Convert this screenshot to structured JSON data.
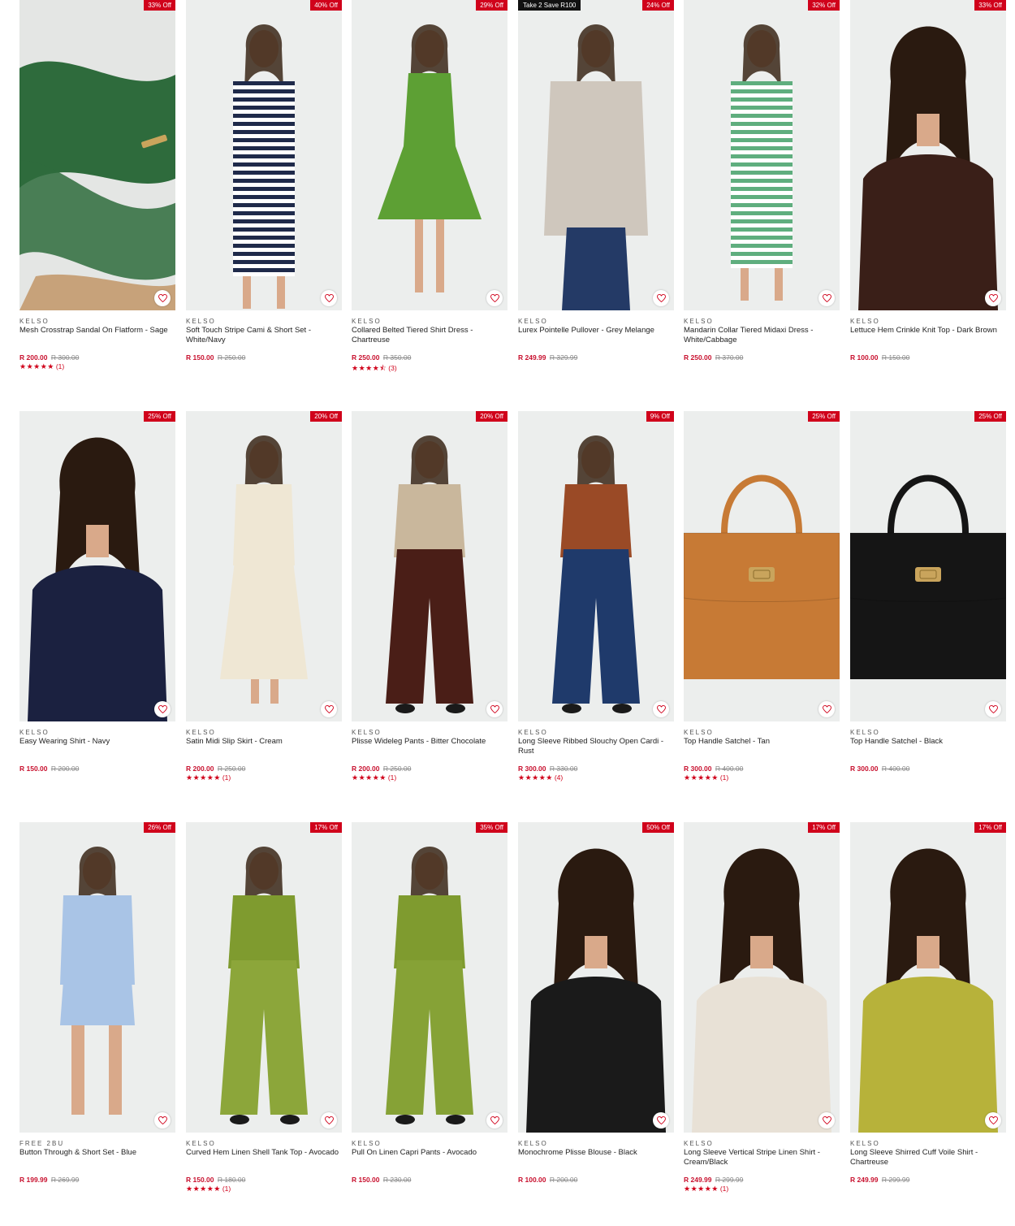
{
  "colors": {
    "accent": "#d0021b",
    "price": "#c8102e",
    "image_bg": "#eceeed"
  },
  "products": [
    {
      "badge": "33% Off",
      "promo": "",
      "brand": "KELSO",
      "name": "Mesh Crosstrap Sandal On Flatform - Sage",
      "price": "R 200.00",
      "was": "R 300.00",
      "stars": "★★★★★",
      "reviews": "(1)",
      "kind": "sandal",
      "color": "#2e6b3c",
      "rating_value": 5
    },
    {
      "badge": "40% Off",
      "promo": "",
      "brand": "KELSO",
      "name": "Soft Touch Stripe Cami & Short Set - White/Navy",
      "price": "R 150.00",
      "was": "R 250.00",
      "stars": "",
      "reviews": "",
      "kind": "stripe",
      "color": "#1f2a4a"
    },
    {
      "badge": "29% Off",
      "promo": "",
      "brand": "KELSO",
      "name": "Collared Belted Tiered Shirt Dress - Chartreuse",
      "price": "R 250.00",
      "was": "R 350.00",
      "stars": "★★★★⯪",
      "reviews": "(3)",
      "kind": "dress",
      "color": "#5da034",
      "rating_value": 4.5
    },
    {
      "badge": "24% Off",
      "promo": "Take 2 Save R100",
      "brand": "KELSO",
      "name": "Lurex Pointelle Pullover - Grey Melange",
      "price": "R 249.99",
      "was": "R 329.99",
      "stars": "",
      "reviews": "",
      "kind": "top-jeans",
      "color": "#cfc7bd"
    },
    {
      "badge": "32% Off",
      "promo": "",
      "brand": "KELSO",
      "name": "Mandarin Collar Tiered Midaxi Dress - White/Cabbage",
      "price": "R 250.00",
      "was": "R 370.00",
      "stars": "",
      "reviews": "",
      "kind": "stripe-dress",
      "color": "#5fae7e"
    },
    {
      "badge": "33% Off",
      "promo": "",
      "brand": "KELSO",
      "name": "Lettuce Hem Crinkle Knit Top - Dark Brown",
      "price": "R 100.00",
      "was": "R 150.00",
      "stars": "",
      "reviews": "",
      "kind": "portrait",
      "color": "#3a1f18"
    },
    {
      "badge": "25% Off",
      "promo": "",
      "brand": "KELSO",
      "name": "Easy Wearing Shirt - Navy",
      "price": "R 150.00",
      "was": "R 200.00",
      "stars": "",
      "reviews": "",
      "kind": "portrait",
      "color": "#1b2140"
    },
    {
      "badge": "20% Off",
      "promo": "",
      "brand": "KELSO",
      "name": "Satin Midi Slip Skirt - Cream",
      "price": "R 200.00",
      "was": "R 250.00",
      "stars": "★★★★★",
      "reviews": "(1)",
      "kind": "full",
      "color": "#efe7d4",
      "rating_value": 5
    },
    {
      "badge": "20% Off",
      "promo": "",
      "brand": "KELSO",
      "name": "Plisse Wideleg Pants - Bitter Chocolate",
      "price": "R 200.00",
      "was": "R 250.00",
      "stars": "★★★★★",
      "reviews": "(1)",
      "kind": "top-pants",
      "color": "#4a1e17",
      "color2": "#c9b79c",
      "rating_value": 5
    },
    {
      "badge": "9% Off",
      "promo": "",
      "brand": "KELSO",
      "name": "Long Sleeve Ribbed Slouchy Open Cardi - Rust",
      "price": "R 300.00",
      "was": "R 330.00",
      "stars": "★★★★★",
      "reviews": "(4)",
      "kind": "top-pants",
      "color": "#1f3a6b",
      "color2": "#9a4a26",
      "rating_value": 5
    },
    {
      "badge": "25% Off",
      "promo": "",
      "brand": "KELSO",
      "name": "Top Handle Satchel - Tan",
      "price": "R 300.00",
      "was": "R 400.00",
      "stars": "★★★★★",
      "reviews": "(1)",
      "kind": "bag",
      "color": "#c77a35",
      "rating_value": 5
    },
    {
      "badge": "25% Off",
      "promo": "",
      "brand": "KELSO",
      "name": "Top Handle Satchel - Black",
      "price": "R 300.00",
      "was": "R 400.00",
      "stars": "",
      "reviews": "",
      "kind": "bag",
      "color": "#151515"
    },
    {
      "badge": "26% Off",
      "promo": "",
      "brand": "FREE 2BU",
      "name": "Button Through & Short Set - Blue",
      "price": "R 199.99",
      "was": "R 269.99",
      "stars": "",
      "reviews": "",
      "kind": "full-short",
      "color": "#a9c4e6"
    },
    {
      "badge": "17% Off",
      "promo": "",
      "brand": "KELSO",
      "name": "Curved Hem Linen Shell Tank Top - Avocado",
      "price": "R 150.00",
      "was": "R 180.00",
      "stars": "★★★★★",
      "reviews": "(1)",
      "kind": "top-pants",
      "color": "#8ca63a",
      "color2": "#7f9b2f",
      "rating_value": 5
    },
    {
      "badge": "35% Off",
      "promo": "",
      "brand": "KELSO",
      "name": "Pull On Linen Capri Pants - Avocado",
      "price": "R 150.00",
      "was": "R 230.00",
      "stars": "",
      "reviews": "",
      "kind": "top-pants",
      "color": "#86a236",
      "color2": "#7f9b2f"
    },
    {
      "badge": "50% Off",
      "promo": "",
      "brand": "KELSO",
      "name": "Monochrome Plisse Blouse - Black",
      "price": "R 100.00",
      "was": "R 200.00",
      "stars": "",
      "reviews": "",
      "kind": "portrait",
      "color": "#1a1a1a"
    },
    {
      "badge": "17% Off",
      "promo": "",
      "brand": "KELSO",
      "name": "Long Sleeve Vertical Stripe Linen Shirt - Cream/Black",
      "price": "R 249.99",
      "was": "R 299.99",
      "stars": "★★★★★",
      "reviews": "(1)",
      "kind": "portrait",
      "color": "#e8e1d6",
      "rating_value": 5
    },
    {
      "badge": "17% Off",
      "promo": "",
      "brand": "KELSO",
      "name": "Long Sleeve Shirred Cuff Voile Shirt - Chartreuse",
      "price": "R 249.99",
      "was": "R 299.99",
      "stars": "",
      "reviews": "",
      "kind": "portrait",
      "color": "#b7b23a"
    }
  ]
}
